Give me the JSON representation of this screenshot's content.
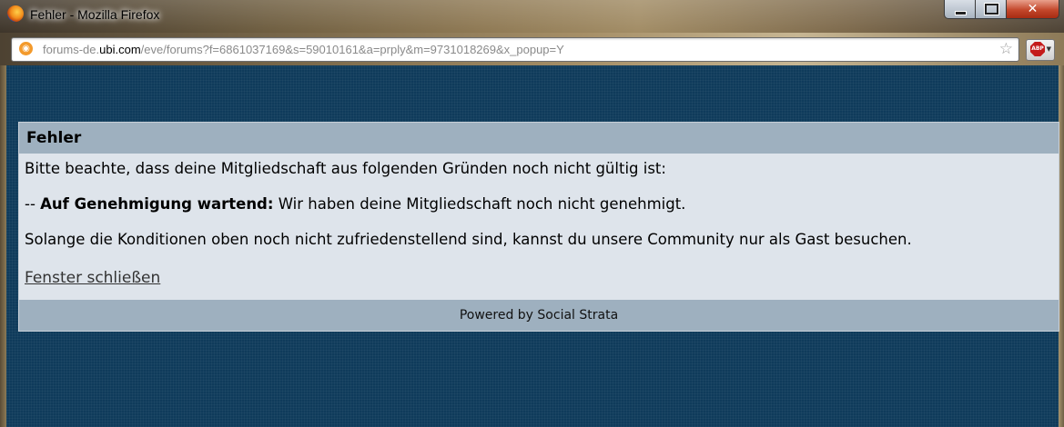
{
  "window": {
    "title": "Fehler - Mozilla Firefox",
    "minimize_icon": "minimize-icon",
    "maximize_icon": "maximize-icon",
    "close_icon": "close-icon"
  },
  "urlbar": {
    "prefix": "forums-de.",
    "host": "ubi.com",
    "path": "/eve/forums?f=6861037169&s=59010161&a=prply&m=9731018269&x_popup=Y",
    "site_icon": "site-favicon",
    "bookmark_icon": "star-icon"
  },
  "addons": {
    "abp_label": "ABP"
  },
  "dialog": {
    "title": "Fehler",
    "intro": "Bitte beachte, dass deine Mitgliedschaft aus folgenden Gründen noch nicht gültig ist:",
    "reason_prefix": "-- ",
    "reason_label": "Auf Genehmigung wartend:",
    "reason_text": " Wir haben deine Mitgliedschaft noch nicht genehmigt.",
    "guest_note": "Solange die Konditionen oben noch nicht zufriedenstellend sind, kannst du unsere Community nur als Gast besuchen.",
    "close_link": "Fenster schließen",
    "footer": "Powered by Social Strata"
  }
}
